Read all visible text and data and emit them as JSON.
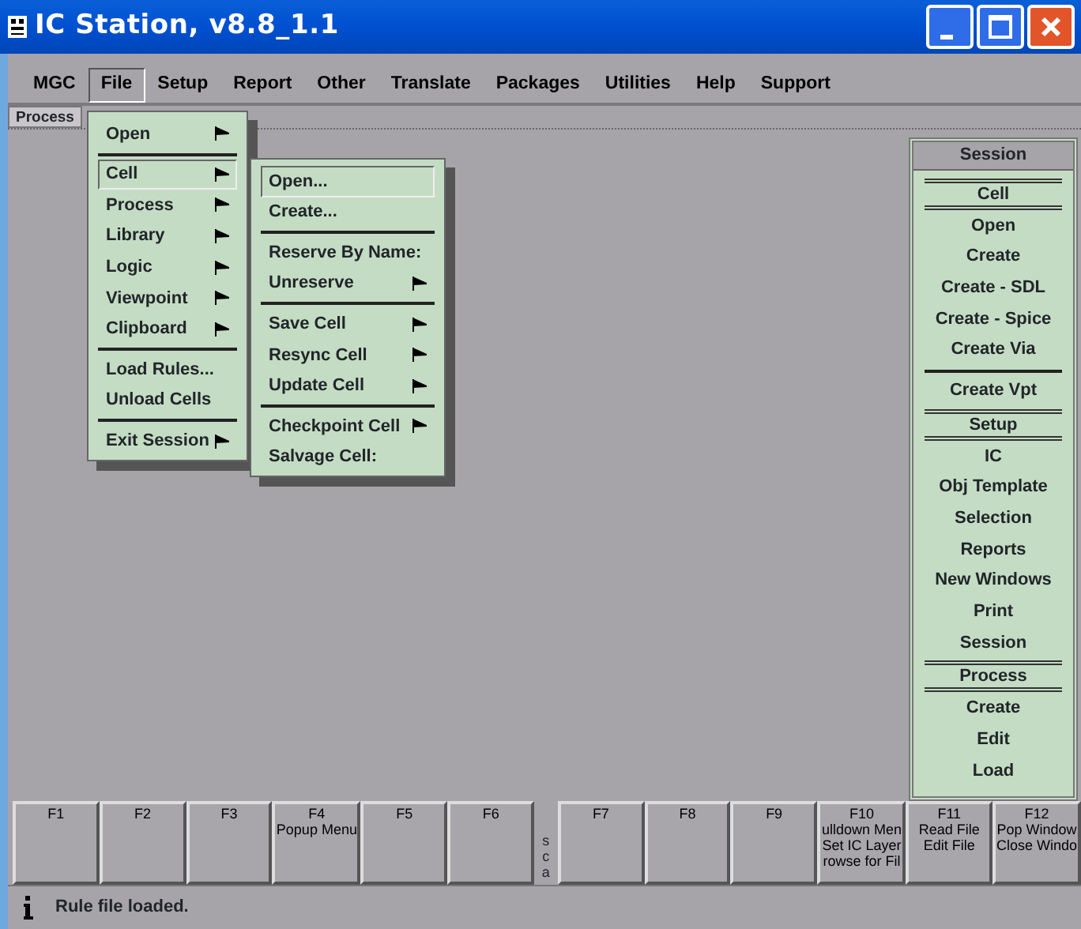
{
  "window": {
    "title": "IC Station, v8.8_1.1"
  },
  "menubar": [
    {
      "label": "MGC",
      "selected": false
    },
    {
      "label": "File",
      "selected": true
    },
    {
      "label": "Setup",
      "selected": false
    },
    {
      "label": "Report",
      "selected": false
    },
    {
      "label": "Other",
      "selected": false
    },
    {
      "label": "Translate",
      "selected": false
    },
    {
      "label": "Packages",
      "selected": false
    },
    {
      "label": "Utilities",
      "selected": false
    },
    {
      "label": "Help",
      "selected": false
    },
    {
      "label": "Support",
      "selected": false
    }
  ],
  "tabs": [
    {
      "label": "Process",
      "selected": true
    }
  ],
  "file_menu": [
    {
      "kind": "item",
      "label": "Open",
      "submenu": true,
      "selected": false
    },
    {
      "kind": "separator"
    },
    {
      "kind": "item",
      "label": "Cell",
      "submenu": true,
      "selected": true
    },
    {
      "kind": "item",
      "label": "Process",
      "submenu": true,
      "selected": false
    },
    {
      "kind": "item",
      "label": "Library",
      "submenu": true,
      "selected": false
    },
    {
      "kind": "item",
      "label": "Logic",
      "submenu": true,
      "selected": false
    },
    {
      "kind": "item",
      "label": "Viewpoint",
      "submenu": true,
      "selected": false
    },
    {
      "kind": "item",
      "label": "Clipboard",
      "submenu": true,
      "selected": false
    },
    {
      "kind": "separator"
    },
    {
      "kind": "item",
      "label": "Load Rules...",
      "submenu": false,
      "selected": false
    },
    {
      "kind": "item",
      "label": "Unload Cells",
      "submenu": false,
      "selected": false
    },
    {
      "kind": "separator"
    },
    {
      "kind": "item",
      "label": "Exit Session",
      "submenu": true,
      "selected": false
    }
  ],
  "cell_menu": [
    {
      "kind": "item",
      "label": "Open...",
      "submenu": false,
      "selected": true
    },
    {
      "kind": "item",
      "label": "Create...",
      "submenu": false,
      "selected": false
    },
    {
      "kind": "separator"
    },
    {
      "kind": "item",
      "label": "Reserve By Name:",
      "submenu": false,
      "selected": false
    },
    {
      "kind": "item",
      "label": "Unreserve",
      "submenu": true,
      "selected": false
    },
    {
      "kind": "separator"
    },
    {
      "kind": "item",
      "label": "Save Cell",
      "submenu": true,
      "selected": false
    },
    {
      "kind": "item",
      "label": "Resync Cell",
      "submenu": true,
      "selected": false
    },
    {
      "kind": "item",
      "label": "Update Cell",
      "submenu": true,
      "selected": false
    },
    {
      "kind": "separator"
    },
    {
      "kind": "item",
      "label": "Checkpoint Cell",
      "submenu": true,
      "selected": false
    },
    {
      "kind": "item",
      "label": "Salvage Cell:",
      "submenu": false,
      "selected": false
    }
  ],
  "session_panel": {
    "title": "Session",
    "rows": [
      {
        "kind": "header",
        "label": "Cell"
      },
      {
        "kind": "item",
        "label": "Open"
      },
      {
        "kind": "item",
        "label": "Create"
      },
      {
        "kind": "item",
        "label": "Create - SDL"
      },
      {
        "kind": "item",
        "label": "Create - Spice"
      },
      {
        "kind": "item",
        "label": "Create Via"
      },
      {
        "kind": "separator"
      },
      {
        "kind": "item",
        "label": "Create Vpt"
      },
      {
        "kind": "header",
        "label": "Setup"
      },
      {
        "kind": "item",
        "label": "IC"
      },
      {
        "kind": "item",
        "label": "Obj Template"
      },
      {
        "kind": "item",
        "label": "Selection"
      },
      {
        "kind": "item",
        "label": "Reports"
      },
      {
        "kind": "item",
        "label": "New Windows"
      },
      {
        "kind": "item",
        "label": "Print"
      },
      {
        "kind": "item",
        "label": "Session"
      },
      {
        "kind": "header",
        "label": "Process"
      },
      {
        "kind": "item",
        "label": "Create"
      },
      {
        "kind": "item",
        "label": "Edit"
      },
      {
        "kind": "item",
        "label": "Load"
      }
    ]
  },
  "function_keys": [
    {
      "kind": "key",
      "key": "F1"
    },
    {
      "kind": "key",
      "key": "F2"
    },
    {
      "kind": "key",
      "key": "F3"
    },
    {
      "kind": "key",
      "key": "F4",
      "lines": [
        "Popup Menu"
      ]
    },
    {
      "kind": "key",
      "key": "F5"
    },
    {
      "kind": "key",
      "key": "F6"
    },
    {
      "kind": "spacer",
      "key": "sca"
    },
    {
      "kind": "key",
      "key": "F7"
    },
    {
      "kind": "key",
      "key": "F8"
    },
    {
      "kind": "key",
      "key": "F9"
    },
    {
      "kind": "key",
      "key": "F10",
      "lines": [
        "ulldown Men",
        "Set IC Layer",
        "rowse for Fil"
      ]
    },
    {
      "kind": "key",
      "key": "F11",
      "lines": [
        "Read File",
        "Edit File"
      ]
    },
    {
      "kind": "key",
      "key": "F12",
      "lines": [
        "Pop Window",
        "Close Windo"
      ]
    }
  ],
  "status_bar": {
    "message": "Rule file loaded."
  }
}
